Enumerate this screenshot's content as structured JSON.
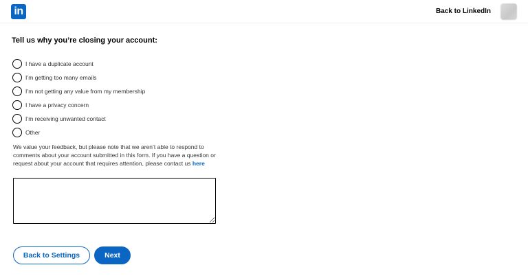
{
  "header": {
    "logo_text": "in",
    "back_link": "Back to LinkedIn"
  },
  "form": {
    "heading": "Tell us why you’re closing your account:",
    "options": [
      "I have a duplicate account",
      "I’m getting too many emails",
      "I’m not getting any value from my membership",
      "I have a privacy concern",
      "I’m receiving unwanted contact",
      "Other"
    ],
    "note_text": "We value your feedback, but please note that we aren’t able to respond to comments about your account submitted in this form. If you have a question or request about your account that requires attention, please contact us ",
    "note_link": "here",
    "feedback_value": ""
  },
  "actions": {
    "back_label": "Back to Settings",
    "next_label": "Next"
  },
  "colors": {
    "brand": "#0a66c2"
  }
}
